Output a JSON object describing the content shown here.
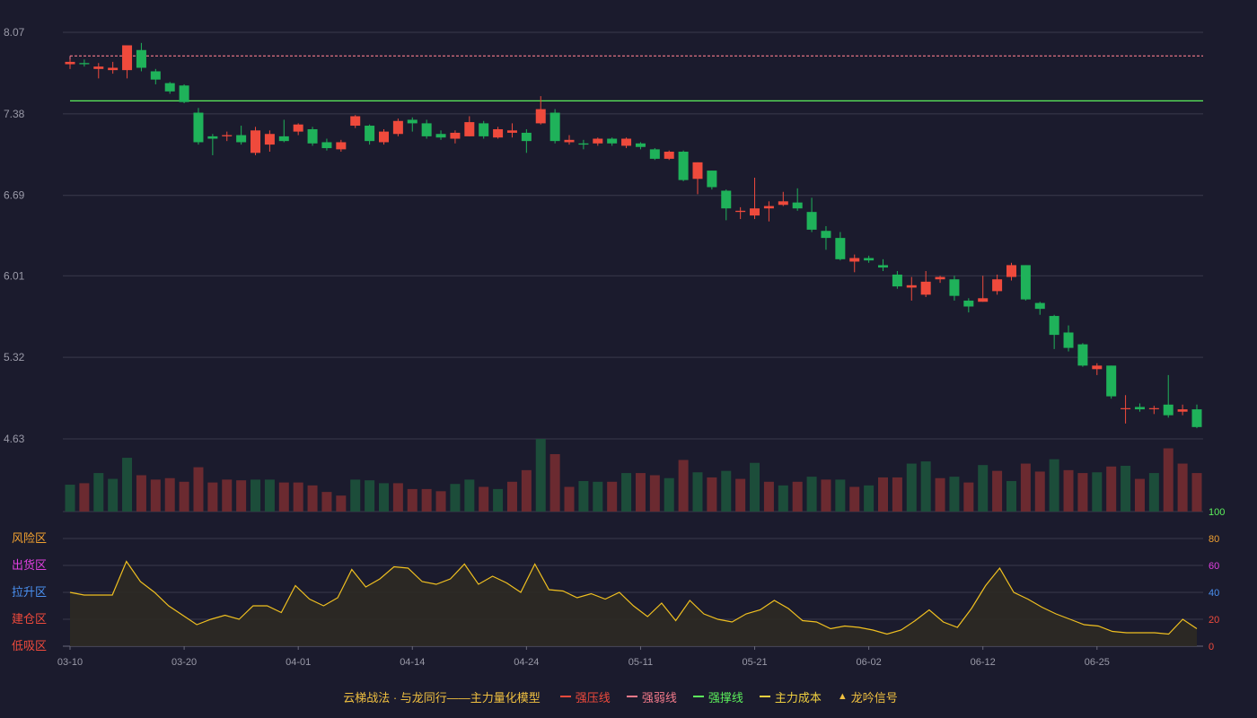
{
  "legend": {
    "title": "云梯战法 · 与龙同行——主力量化模型",
    "items": [
      {
        "label": "强压线",
        "color": "#ef4a3c",
        "style": "solid"
      },
      {
        "label": "强弱线",
        "color": "#f47a8a",
        "style": "dash"
      },
      {
        "label": "强撑线",
        "color": "#5cf05c",
        "style": "solid"
      },
      {
        "label": "主力成本",
        "color": "#f0d040",
        "style": "dash"
      },
      {
        "label": "龙吟信号",
        "color": "#f0c040",
        "style": "triangle"
      }
    ]
  },
  "colors": {
    "background": "#1b1b2d",
    "grid": "#3a3a4c",
    "up": "#ef4a3c",
    "down": "#1fb25a",
    "vol_up": "#6b2a30",
    "vol_down": "#1c4d3a",
    "osc_line": "#f0c020",
    "osc_fill": "#2e2a24",
    "axis_text": "#9a9aa8"
  },
  "chart_data": [
    {
      "type": "candlestick",
      "ylim": [
        4.63,
        8.07
      ],
      "yticks": [
        "8.07",
        "7.38",
        "6.69",
        "6.01",
        "5.32",
        "4.63"
      ],
      "xtick_labels": [
        "03-10",
        "03-20",
        "04-01",
        "04-14",
        "04-24",
        "05-11",
        "05-21",
        "06-02",
        "06-12",
        "06-25"
      ],
      "xtick_index": [
        0,
        8,
        16,
        24,
        32,
        40,
        48,
        56,
        64,
        72
      ],
      "hlines": [
        {
          "name": "强弱线",
          "value": 7.87,
          "color": "#f47a8a",
          "style": "dash"
        },
        {
          "name": "强撑线",
          "value": 7.49,
          "color": "#5cf05c",
          "style": "solid"
        }
      ],
      "ohlc": [
        [
          7.8,
          7.82,
          7.76,
          7.84
        ],
        [
          7.81,
          7.8,
          7.78,
          7.84
        ],
        [
          7.76,
          7.78,
          7.68,
          7.81
        ],
        [
          7.75,
          7.77,
          7.72,
          7.82
        ],
        [
          7.75,
          7.96,
          7.68,
          7.96
        ],
        [
          7.92,
          7.77,
          7.74,
          7.98
        ],
        [
          7.74,
          7.67,
          7.63,
          7.76
        ],
        [
          7.64,
          7.57,
          7.55,
          7.65
        ],
        [
          7.62,
          7.48,
          7.47,
          7.63
        ],
        [
          7.39,
          7.14,
          7.12,
          7.43
        ],
        [
          7.19,
          7.17,
          7.03,
          7.21
        ],
        [
          7.19,
          7.2,
          7.15,
          7.23
        ],
        [
          7.2,
          7.14,
          7.12,
          7.28
        ],
        [
          7.05,
          7.24,
          7.03,
          7.27
        ],
        [
          7.12,
          7.21,
          7.06,
          7.24
        ],
        [
          7.19,
          7.15,
          7.14,
          7.33
        ],
        [
          7.23,
          7.29,
          7.2,
          7.3
        ],
        [
          7.25,
          7.13,
          7.11,
          7.27
        ],
        [
          7.14,
          7.09,
          7.07,
          7.17
        ],
        [
          7.08,
          7.14,
          7.06,
          7.16
        ],
        [
          7.28,
          7.36,
          7.26,
          7.37
        ],
        [
          7.28,
          7.15,
          7.12,
          7.29
        ],
        [
          7.14,
          7.23,
          7.12,
          7.25
        ],
        [
          7.21,
          7.32,
          7.19,
          7.34
        ],
        [
          7.33,
          7.3,
          7.23,
          7.35
        ],
        [
          7.3,
          7.19,
          7.17,
          7.33
        ],
        [
          7.21,
          7.18,
          7.16,
          7.24
        ],
        [
          7.17,
          7.22,
          7.13,
          7.24
        ],
        [
          7.19,
          7.31,
          7.19,
          7.36
        ],
        [
          7.3,
          7.19,
          7.17,
          7.32
        ],
        [
          7.18,
          7.25,
          7.17,
          7.27
        ],
        [
          7.22,
          7.24,
          7.18,
          7.3
        ],
        [
          7.22,
          7.15,
          7.05,
          7.25
        ],
        [
          7.3,
          7.42,
          7.29,
          7.53
        ],
        [
          7.39,
          7.15,
          7.13,
          7.42
        ],
        [
          7.14,
          7.16,
          7.12,
          7.2
        ],
        [
          7.13,
          7.12,
          7.08,
          7.16
        ],
        [
          7.13,
          7.17,
          7.11,
          7.18
        ],
        [
          7.17,
          7.13,
          7.11,
          7.18
        ],
        [
          7.11,
          7.17,
          7.09,
          7.18
        ],
        [
          7.13,
          7.1,
          7.08,
          7.14
        ],
        [
          7.08,
          7.0,
          6.99,
          7.09
        ],
        [
          7.0,
          7.06,
          6.99,
          7.07
        ],
        [
          7.06,
          6.82,
          6.81,
          7.07
        ],
        [
          6.83,
          6.97,
          6.7,
          6.97
        ],
        [
          6.9,
          6.76,
          6.74,
          6.9
        ],
        [
          6.73,
          6.58,
          6.48,
          6.74
        ],
        [
          6.55,
          6.56,
          6.49,
          6.59
        ],
        [
          6.52,
          6.58,
          6.49,
          6.84
        ],
        [
          6.58,
          6.6,
          6.47,
          6.64
        ],
        [
          6.61,
          6.64,
          6.6,
          6.72
        ],
        [
          6.63,
          6.58,
          6.56,
          6.75
        ],
        [
          6.55,
          6.4,
          6.38,
          6.67
        ],
        [
          6.39,
          6.33,
          6.23,
          6.43
        ],
        [
          6.33,
          6.15,
          6.14,
          6.38
        ],
        [
          6.13,
          6.16,
          6.04,
          6.19
        ],
        [
          6.16,
          6.14,
          6.12,
          6.18
        ],
        [
          6.1,
          6.08,
          6.05,
          6.15
        ],
        [
          6.02,
          5.92,
          5.9,
          6.05
        ],
        [
          5.91,
          5.93,
          5.8,
          6.0
        ],
        [
          5.85,
          5.96,
          5.83,
          6.05
        ],
        [
          5.98,
          6.0,
          5.95,
          6.01
        ],
        [
          5.98,
          5.84,
          5.8,
          6.01
        ],
        [
          5.8,
          5.75,
          5.7,
          5.82
        ],
        [
          5.79,
          5.82,
          5.79,
          6.01
        ],
        [
          5.88,
          5.98,
          5.85,
          6.02
        ],
        [
          6.0,
          6.1,
          5.97,
          6.12
        ],
        [
          6.1,
          5.81,
          5.8,
          6.1
        ],
        [
          5.78,
          5.73,
          5.68,
          5.79
        ],
        [
          5.67,
          5.51,
          5.39,
          5.68
        ],
        [
          5.53,
          5.4,
          5.37,
          5.59
        ],
        [
          5.43,
          5.25,
          5.24,
          5.44
        ],
        [
          5.22,
          5.25,
          5.17,
          5.27
        ],
        [
          5.25,
          4.99,
          4.97,
          5.25
        ],
        [
          4.89,
          4.89,
          4.76,
          5.0
        ],
        [
          4.9,
          4.88,
          4.86,
          4.93
        ],
        [
          4.89,
          4.89,
          4.84,
          4.91
        ],
        [
          4.92,
          4.83,
          4.81,
          5.17
        ],
        [
          4.86,
          4.88,
          4.83,
          4.92
        ],
        [
          4.88,
          4.73,
          4.72,
          4.92
        ]
      ]
    },
    {
      "type": "bar",
      "title": "volume",
      "values": [
        37,
        39,
        53,
        45,
        74,
        50,
        44,
        46,
        41,
        61,
        40,
        44,
        43,
        44,
        44,
        40,
        40,
        36,
        27,
        22,
        44,
        43,
        39,
        39,
        31,
        31,
        28,
        38,
        44,
        34,
        31,
        41,
        57,
        100,
        79,
        34,
        42,
        41,
        41,
        53,
        53,
        50,
        46,
        71,
        54,
        47,
        56,
        45,
        67,
        41,
        36,
        41,
        48,
        44,
        44,
        34,
        36,
        47,
        47,
        66,
        69,
        46,
        48,
        40,
        64,
        56,
        42,
        66,
        55,
        72,
        57,
        53,
        54,
        62,
        63,
        45,
        53,
        87,
        66,
        53
      ],
      "up_flags": [
        0,
        1,
        0,
        0,
        0,
        1,
        1,
        1,
        1,
        1,
        1,
        1,
        1,
        0,
        0,
        1,
        1,
        1,
        1,
        1,
        0,
        0,
        0,
        1,
        1,
        1,
        1,
        0,
        0,
        1,
        0,
        1,
        1,
        0,
        1,
        1,
        0,
        0,
        1,
        0,
        1,
        1,
        0,
        1,
        0,
        1,
        0,
        1,
        0,
        1,
        0,
        1,
        0,
        1,
        0,
        1,
        0,
        1,
        1,
        0,
        0,
        1,
        0,
        1,
        0,
        1,
        0,
        1,
        1,
        0,
        1,
        1,
        0,
        1,
        0,
        1,
        0,
        1,
        1,
        1
      ]
    },
    {
      "type": "area",
      "title": "oscillator",
      "ylim": [
        0,
        100
      ],
      "yticks": [
        "100",
        "80",
        "60",
        "40",
        "20",
        "0"
      ],
      "ytick_colors": [
        "#5cf05c",
        "#f0a030",
        "#e040e0",
        "#4a90f0",
        "#ef4a3c",
        "#ef4a3c"
      ],
      "zones": [
        {
          "label": "风险区",
          "value": 80,
          "color": "#f0a030"
        },
        {
          "label": "出货区",
          "value": 60,
          "color": "#e040e0"
        },
        {
          "label": "拉升区",
          "value": 40,
          "color": "#4a90f0"
        },
        {
          "label": "建仓区",
          "value": 20,
          "color": "#ef4a3c"
        },
        {
          "label": "低吸区",
          "value": 0,
          "color": "#ef4a3c"
        }
      ],
      "values": [
        40,
        38,
        38,
        38,
        63,
        48,
        40,
        30,
        23,
        16,
        20,
        23,
        20,
        30,
        30,
        25,
        45,
        35,
        30,
        36,
        57,
        44,
        50,
        59,
        58,
        48,
        46,
        50,
        61,
        46,
        52,
        47,
        40,
        61,
        42,
        41,
        36,
        39,
        35,
        40,
        30,
        22,
        32,
        19,
        34,
        24,
        20,
        18,
        24,
        27,
        34,
        28,
        19,
        18,
        13,
        15,
        14,
        12,
        9,
        12,
        19,
        27,
        18,
        14,
        28,
        45,
        58,
        40,
        35,
        29,
        24,
        20,
        16,
        15,
        11,
        10,
        10,
        10,
        9,
        20,
        13
      ]
    }
  ]
}
